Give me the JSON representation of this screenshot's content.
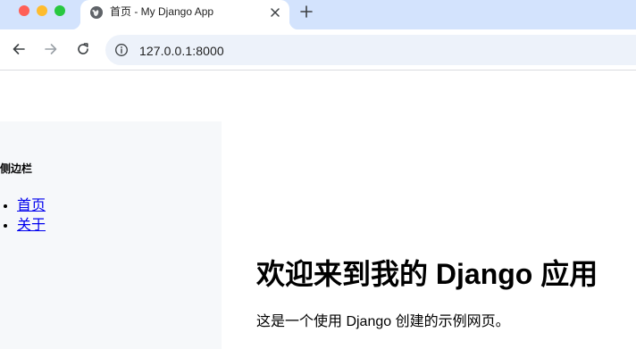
{
  "browser": {
    "tab_title": "首页 - My Django App",
    "url": "127.0.0.1:8000"
  },
  "page": {
    "sidebar_heading": "侧边栏",
    "sidebar_links": [
      "首页",
      "关于"
    ],
    "heading": "欢迎来到我的 Django 应用",
    "paragraph": "这是一个使用 Django 创建的示例网页。"
  },
  "icons": {
    "favicon": "globe-icon",
    "tab_close": "close-icon",
    "new_tab": "plus-icon",
    "back": "arrow-left-icon",
    "forward": "arrow-right-icon",
    "reload": "reload-icon",
    "site_info": "info-icon"
  },
  "colors": {
    "tabstrip": "#d3e3fd",
    "omnibox": "#edf2fa",
    "sidebar": "#f6f8fa",
    "link": "#0000ee"
  }
}
